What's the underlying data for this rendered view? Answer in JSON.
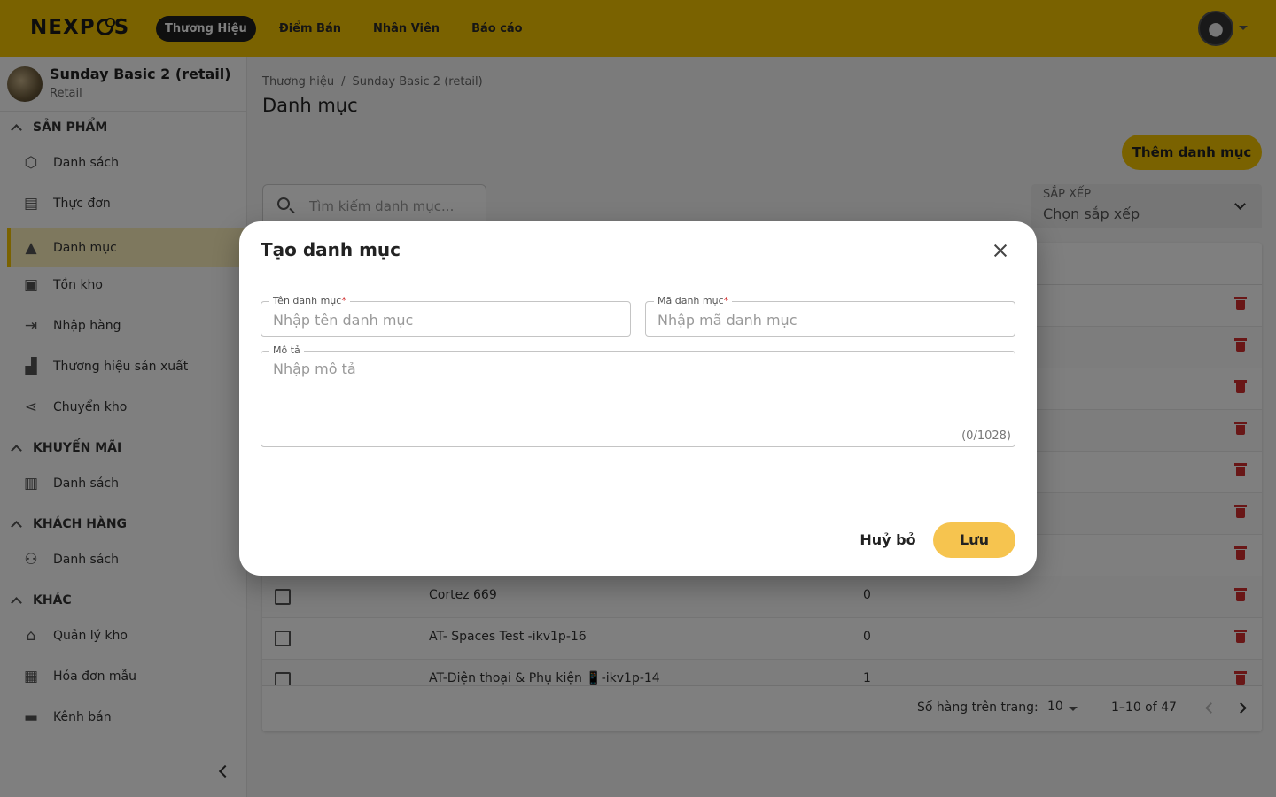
{
  "topbar": {
    "logo": "NEXPOS",
    "nav": [
      "Thương Hiệu",
      "Điểm Bán",
      "Nhân Viên",
      "Báo cáo"
    ]
  },
  "sidebar": {
    "brand_name": "Sunday Basic 2 (retail)",
    "brand_sub": "Retail",
    "sections": [
      {
        "title": "SẢN PHẨM",
        "items": [
          "Danh sách",
          "Thực đơn",
          "Danh mục",
          "Tồn kho",
          "Nhập hàng",
          "Thương hiệu sản xuất",
          "Chuyển kho"
        ]
      },
      {
        "title": "KHUYẾN MÃI",
        "items": [
          "Danh sách"
        ]
      },
      {
        "title": "KHÁCH HÀNG",
        "items": [
          "Danh sách"
        ]
      },
      {
        "title": "KHÁC",
        "items": [
          "Quản lý kho",
          "Hóa đơn mẫu",
          "Kênh bán"
        ]
      }
    ]
  },
  "main": {
    "breadcrumb": [
      "Thương hiệu",
      "Sunday Basic 2 (retail)"
    ],
    "breadcrumb_sep": "/",
    "title": "Danh mục",
    "add_button": "Thêm danh mục",
    "search_placeholder": "Tìm kiếm danh mục...",
    "sort_label": "SẮP XẾP",
    "sort_value": "Chọn sắp xếp",
    "rows": [
      {
        "name": "Cortez 669",
        "count": "0"
      },
      {
        "name": "AT- Spaces Test -ikv1p-16",
        "count": "0"
      },
      {
        "name": "AT-Điện thoại & Phụ kiện 📱-ikv1p-14",
        "count": "1"
      }
    ],
    "footer": {
      "rows_label": "Số hàng trên trang:",
      "rows_value": "10",
      "range": "1–10 of 47"
    }
  },
  "modal": {
    "title": "Tạo danh mục",
    "name_label": "Tên danh mục",
    "name_placeholder": "Nhập tên danh mục",
    "code_label": "Mã danh mục",
    "code_placeholder": "Nhập mã danh mục",
    "desc_label": "Mô tả",
    "desc_placeholder": "Nhập mô tả",
    "required_mark": "*",
    "counter": "(0/1028)",
    "cancel": "Huỷ bỏ",
    "save": "Lưu"
  },
  "colors": {
    "brand_yellow": "#f5c400",
    "save_button": "#f6c44f",
    "delete_red": "#d32f2f"
  }
}
